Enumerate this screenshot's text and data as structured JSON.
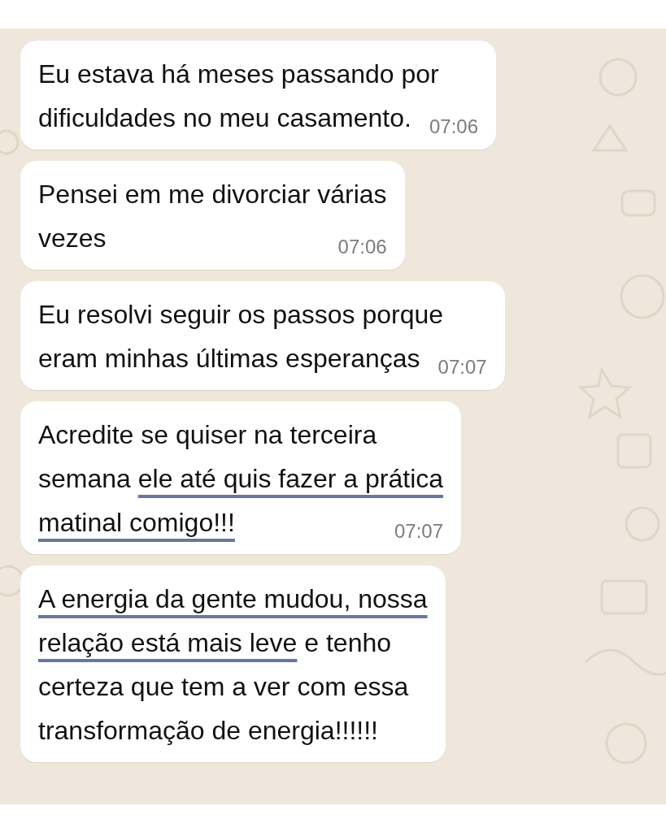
{
  "messages": [
    {
      "segments": [
        {
          "text": "Eu estava há meses passando por\ndificuldades no meu casamento.",
          "underlined": false
        }
      ],
      "time": "07:06"
    },
    {
      "segments": [
        {
          "text": "Pensei em me divorciar várias\nvezes",
          "underlined": false
        }
      ],
      "time": "07:06"
    },
    {
      "segments": [
        {
          "text": "Eu resolvi seguir os passos porque\neram minhas últimas esperanças",
          "underlined": false
        }
      ],
      "time": "07:07"
    },
    {
      "segments": [
        {
          "text": "Acredite se quiser na terceira\nsemana ",
          "underlined": false
        },
        {
          "text": "ele até quis fazer a prática\nmatinal comigo!!!",
          "underlined": true
        }
      ],
      "time": "07:07"
    },
    {
      "segments": [
        {
          "text": "A energia da gente mudou, nossa\nrelação está mais leve",
          "underlined": true
        },
        {
          "text": " e tenho\ncerteza que tem a ver com essa\ntransformação de energia!!!!!!",
          "underlined": false
        }
      ]
    }
  ]
}
